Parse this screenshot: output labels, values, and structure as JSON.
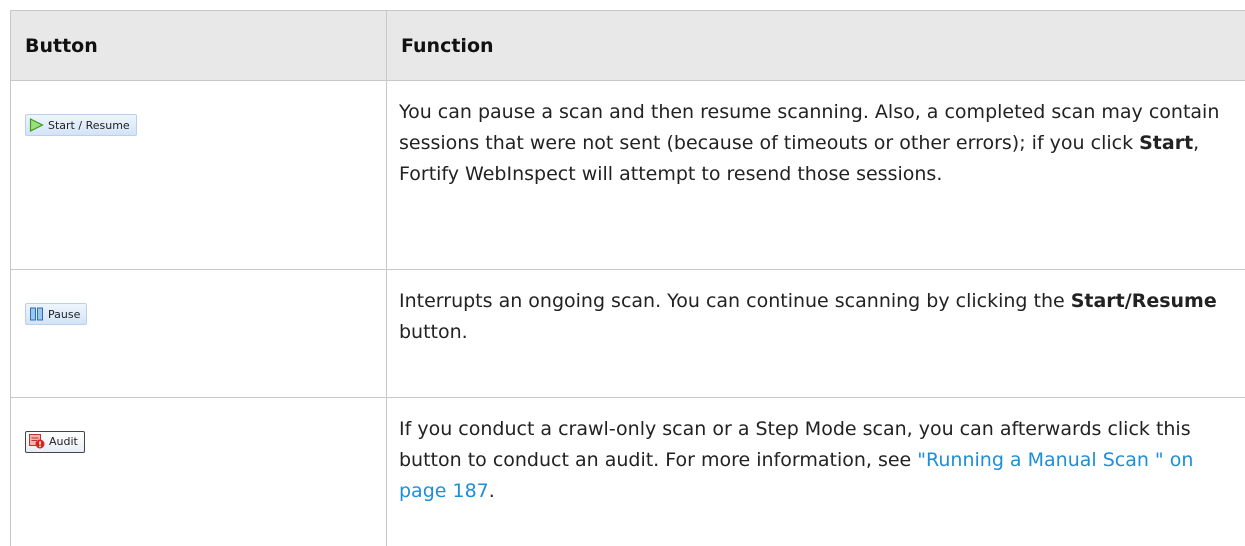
{
  "headers": {
    "button": "Button",
    "function": "Function"
  },
  "rows": [
    {
      "button_label": "Start / Resume",
      "icon": "play-triangle-icon",
      "desc_1": "You can pause a scan and then resume scanning. Also, a completed scan may contain sessions that were not sent (because of timeouts or other errors); if you click ",
      "desc_bold": "Start",
      "desc_2": ", Fortify WebInspect will attempt to resend those sessions."
    },
    {
      "button_label": "Pause",
      "icon": "pause-bars-icon",
      "desc_1": "Interrupts an ongoing scan. You can continue scanning by clicking the ",
      "desc_bold": "Start/Resume",
      "desc_2": " button."
    },
    {
      "button_label": "Audit",
      "icon": "audit-alert-icon",
      "desc_1": "If you conduct a crawl-only scan or a Step Mode scan, you can afterwards click this button to conduct an audit. For more information, see ",
      "link": "\"Running a Manual Scan \" on page 187",
      "desc_2": "."
    }
  ],
  "colors": {
    "link": "#1c8fd8",
    "header_bg": "#e8e8e8",
    "border": "#c8c8c8"
  }
}
